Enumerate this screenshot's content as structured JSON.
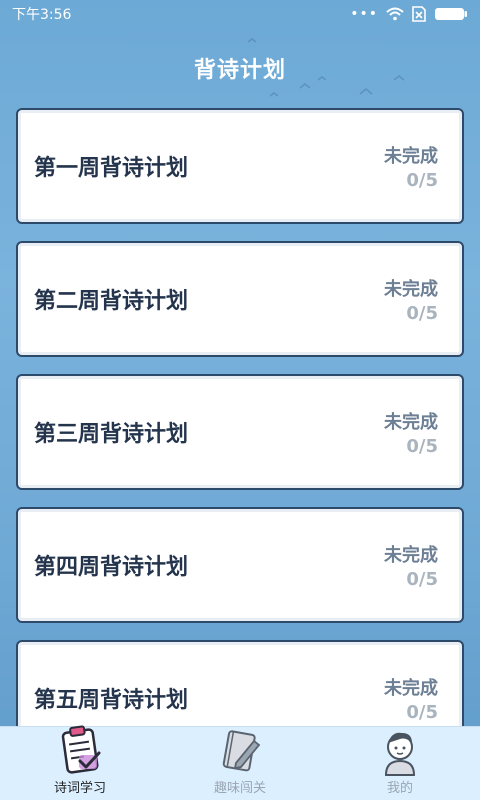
{
  "status_bar": {
    "time": "下午3:56",
    "dots": "•••"
  },
  "header": {
    "title": "背诗计划"
  },
  "plans": [
    {
      "title": "第一周背诗计划",
      "state": "未完成",
      "progress": "0/5"
    },
    {
      "title": "第二周背诗计划",
      "state": "未完成",
      "progress": "0/5"
    },
    {
      "title": "第三周背诗计划",
      "state": "未完成",
      "progress": "0/5"
    },
    {
      "title": "第四周背诗计划",
      "state": "未完成",
      "progress": "0/5"
    },
    {
      "title": "第五周背诗计划",
      "state": "未完成",
      "progress": "0/5"
    }
  ],
  "tabbar": {
    "tabs": [
      {
        "label": "诗词学习",
        "icon": "clipboard-check-icon",
        "active": true
      },
      {
        "label": "趣味闯关",
        "icon": "notebook-pencil-icon",
        "active": false
      },
      {
        "label": "我的",
        "icon": "user-avatar-icon",
        "active": false
      }
    ]
  },
  "colors": {
    "background": "#6da9d6",
    "card_border": "#2d4a6b",
    "title_text": "#24344d",
    "tabbar_bg": "#dcefff"
  }
}
